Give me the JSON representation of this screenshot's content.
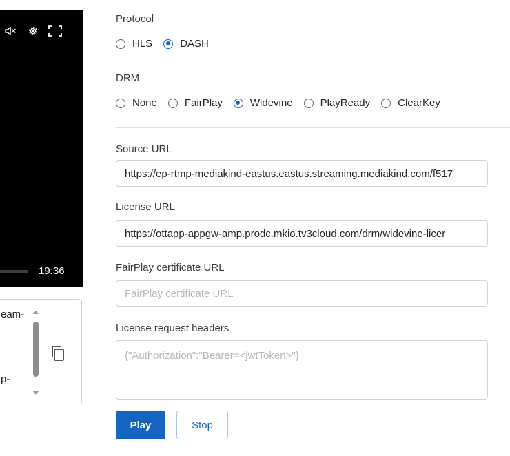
{
  "player": {
    "time": "19:36",
    "icons": [
      "mute-icon",
      "gear-icon",
      "fullscreen-icon"
    ]
  },
  "panel": {
    "snippet_1": "eam-",
    "snippet_2": "p-",
    "copy_icon": "copy-icon"
  },
  "form": {
    "protocol": {
      "label": "Protocol",
      "options": [
        {
          "label": "HLS",
          "checked": false
        },
        {
          "label": "DASH",
          "checked": true
        }
      ]
    },
    "drm": {
      "label": "DRM",
      "options": [
        {
          "label": "None",
          "checked": false
        },
        {
          "label": "FairPlay",
          "checked": false
        },
        {
          "label": "Widevine",
          "checked": true
        },
        {
          "label": "PlayReady",
          "checked": false
        },
        {
          "label": "ClearKey",
          "checked": false
        }
      ]
    },
    "source_url": {
      "label": "Source URL",
      "value": "https://ep-rtmp-mediakind-eastus.eastus.streaming.mediakind.com/f517"
    },
    "license_url": {
      "label": "License URL",
      "value": "https://ottapp-appgw-amp.prodc.mkio.tv3cloud.com/drm/widevine-licer"
    },
    "fairplay_cert_url": {
      "label": "FairPlay certificate URL",
      "value": "",
      "placeholder": "FairPlay certificate URL"
    },
    "license_headers": {
      "label": "License request headers",
      "value": "",
      "placeholder": "{\"Authorization\":\"Bearer=<jwtToken>\"}"
    }
  },
  "actions": {
    "play_label": "Play",
    "stop_label": "Stop"
  },
  "colors": {
    "accent": "#1565c0",
    "player_bg": "#000000",
    "border": "#ced4da"
  }
}
